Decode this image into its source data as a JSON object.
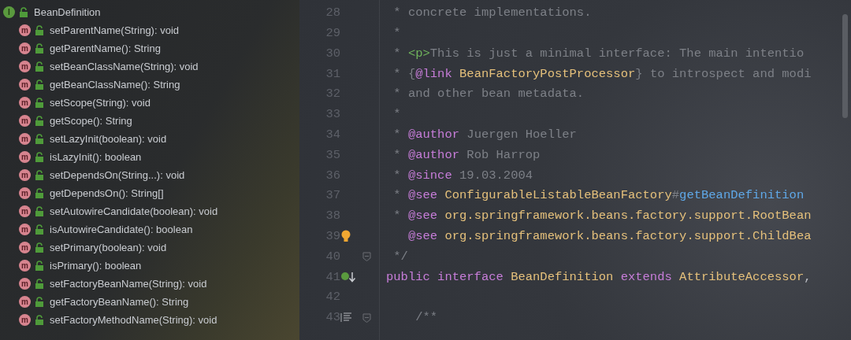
{
  "structure": {
    "root": {
      "badge": "I",
      "label": "BeanDefinition",
      "children": [
        {
          "badge": "m",
          "label": "setParentName(String): void"
        },
        {
          "badge": "m",
          "label": "getParentName(): String"
        },
        {
          "badge": "m",
          "label": "setBeanClassName(String): void"
        },
        {
          "badge": "m",
          "label": "getBeanClassName(): String"
        },
        {
          "badge": "m",
          "label": "setScope(String): void"
        },
        {
          "badge": "m",
          "label": "getScope(): String"
        },
        {
          "badge": "m",
          "label": "setLazyInit(boolean): void"
        },
        {
          "badge": "m",
          "label": "isLazyInit(): boolean"
        },
        {
          "badge": "m",
          "label": "setDependsOn(String...): void"
        },
        {
          "badge": "m",
          "label": "getDependsOn(): String[]"
        },
        {
          "badge": "m",
          "label": "setAutowireCandidate(boolean): void"
        },
        {
          "badge": "m",
          "label": "isAutowireCandidate(): boolean"
        },
        {
          "badge": "m",
          "label": "setPrimary(boolean): void"
        },
        {
          "badge": "m",
          "label": "isPrimary(): boolean"
        },
        {
          "badge": "m",
          "label": "setFactoryBeanName(String): void"
        },
        {
          "badge": "m",
          "label": "getFactoryBeanName(): String"
        },
        {
          "badge": "m",
          "label": "setFactoryMethodName(String): void"
        }
      ]
    }
  },
  "editor": {
    "lines": [
      {
        "number": "28",
        "tokens": [
          {
            "kind": "comment",
            "text": " * concrete implementations."
          }
        ]
      },
      {
        "number": "29",
        "tokens": [
          {
            "kind": "comment",
            "text": " *"
          }
        ]
      },
      {
        "number": "30",
        "tokens": [
          {
            "kind": "comment",
            "text": " * "
          },
          {
            "kind": "tag",
            "text": "<p>"
          },
          {
            "kind": "comment",
            "text": "This is just a minimal interface: The main intentio"
          }
        ]
      },
      {
        "number": "31",
        "tokens": [
          {
            "kind": "comment",
            "text": " * {"
          },
          {
            "kind": "doctag",
            "text": "@link"
          },
          {
            "kind": "ref",
            "text": " BeanFactoryPostProcessor"
          },
          {
            "kind": "comment",
            "text": "} to introspect and modi"
          }
        ]
      },
      {
        "number": "32",
        "tokens": [
          {
            "kind": "comment",
            "text": " * and other bean metadata."
          }
        ]
      },
      {
        "number": "33",
        "tokens": [
          {
            "kind": "comment",
            "text": " *"
          }
        ]
      },
      {
        "number": "34",
        "tokens": [
          {
            "kind": "comment",
            "text": " * "
          },
          {
            "kind": "doctag",
            "text": "@author"
          },
          {
            "kind": "comment",
            "text": " Juergen Hoeller"
          }
        ]
      },
      {
        "number": "35",
        "tokens": [
          {
            "kind": "comment",
            "text": " * "
          },
          {
            "kind": "doctag",
            "text": "@author"
          },
          {
            "kind": "comment",
            "text": " Rob Harrop"
          }
        ]
      },
      {
        "number": "36",
        "tokens": [
          {
            "kind": "comment",
            "text": " * "
          },
          {
            "kind": "doctag",
            "text": "@since"
          },
          {
            "kind": "comment",
            "text": " 19.03.2004"
          }
        ]
      },
      {
        "number": "37",
        "tokens": [
          {
            "kind": "comment",
            "text": " * "
          },
          {
            "kind": "doctag",
            "text": "@see"
          },
          {
            "kind": "ref",
            "text": " ConfigurableListableBeanFactory"
          },
          {
            "kind": "comment",
            "text": "#"
          },
          {
            "kind": "link",
            "text": "getBeanDefinition"
          }
        ]
      },
      {
        "number": "38",
        "tokens": [
          {
            "kind": "comment",
            "text": " * "
          },
          {
            "kind": "doctag",
            "text": "@see"
          },
          {
            "kind": "ref",
            "text": " org.springframework.beans.factory.support.RootBean"
          }
        ]
      },
      {
        "number": "39",
        "gutter": {
          "kind": "bulb"
        },
        "tokens": [
          {
            "kind": "doctag",
            "text": "   @see"
          },
          {
            "kind": "ref",
            "text": " org.springframework.beans.factory.support.ChildBea"
          }
        ]
      },
      {
        "number": "40",
        "fold": true,
        "tokens": [
          {
            "kind": "comment",
            "text": " */"
          }
        ]
      },
      {
        "number": "41",
        "gutter": {
          "kind": "implemented"
        },
        "tokens": [
          {
            "kind": "keyword",
            "text": "public"
          },
          {
            "kind": "keyword",
            "text": " interface"
          },
          {
            "kind": "ref",
            "text": " BeanDefinition"
          },
          {
            "kind": "keyword",
            "text": " extends"
          },
          {
            "kind": "ref",
            "text": " AttributeAccessor"
          },
          {
            "kind": "plain",
            "text": ","
          }
        ]
      },
      {
        "number": "42"
      },
      {
        "number": "43",
        "gutter": {
          "kind": "doc"
        },
        "fold": true,
        "tokens": [
          {
            "kind": "comment",
            "text": "    /**"
          }
        ]
      }
    ]
  }
}
